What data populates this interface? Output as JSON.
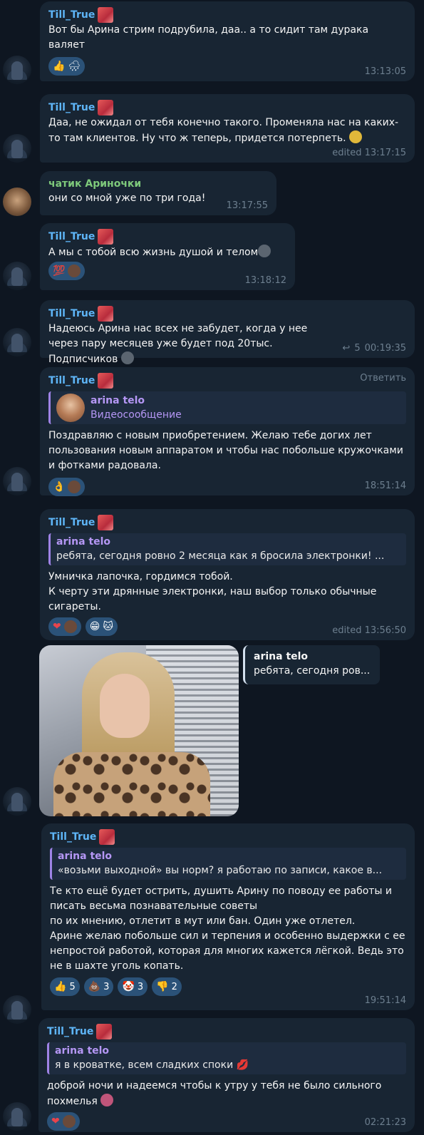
{
  "colors": {
    "background": "#0e1621",
    "bubble": "#182533",
    "name_blue": "#5eb5f7",
    "name_green": "#7ec97b",
    "quote_purple": "#b597f5",
    "time_gray": "#6d7f8f"
  },
  "messages": [
    {
      "author": "Till_True",
      "text": "Вот бы Арина стрим подрубила, даа.. а то сидит там дурака валяет",
      "reactions": [
        "👍",
        "🌧"
      ],
      "time": "13:13:05"
    },
    {
      "author": "Till_True",
      "text": "Даа, не ожидал от тебя конечно такого. Променяла нас на каких-то там клиентов. Ну что ж теперь, придется потерпеть.",
      "time": "edited 13:17:15"
    },
    {
      "author": "чатик Ариночки",
      "text": "они со мной уже по три года!",
      "time": "13:17:55"
    },
    {
      "author": "Till_True",
      "text": "А мы с тобой всю жизнь душой и телом",
      "reactions": [
        "💯",
        ""
      ],
      "time": "13:18:12"
    },
    {
      "author": "Till_True",
      "text": "Надеюсь Арина нас всех не забудет, когда у нее через пару месяцев уже будет под 20тыс. Подписчиков",
      "reply_count": "5",
      "time": "00:19:35"
    },
    {
      "author": "Till_True",
      "reply_action": "Ответить",
      "quote_name": "arina telo",
      "quote_text": "Видеосообщение",
      "text": "Поздравляю с новым приобретением. Желаю тебе догих лет пользования новым аппаратом и чтобы нас побольше кружочками и фотками радовала.",
      "reactions": [
        "👌",
        ""
      ],
      "time": "18:51:14"
    },
    {
      "author": "Till_True",
      "quote_name": "arina telo",
      "quote_text": "ребята, сегодня ровно 2 месяца как я бросила электронки!  ...",
      "text": "Умничка лапочка, гордимся тобой.\nК черту эти дрянные электронки, наш выбор только обычные сигареты.",
      "reactions": [
        "❤",
        "",
        "😁",
        "🐱"
      ],
      "time": "edited 13:56:50"
    },
    {
      "author": "arina telo",
      "quote_text": "ребята, сегодня ров..."
    },
    {
      "author": "Till_True",
      "quote_name": "arina telo",
      "quote_text": "«возьми выходной» вы норм? я работаю по записи, какое в...",
      "text": "Те кто ещё будет острить, душить Арину по поводу ее работы и писать весьма познавательные советы\nпо их мнению, отлетит в мут или бан. Один уже отлетел.\nАрине желаю побольше сил и терпения и особенно выдержки с ее непростой работой, которая для многих кажется лёгкой. Ведь это не в шахте уголь копать.",
      "reactions": [
        {
          "emoji": "👍",
          "count": "5"
        },
        {
          "emoji": "💩",
          "count": "3"
        },
        {
          "emoji": "🤡",
          "count": "3"
        },
        {
          "emoji": "👎",
          "count": "2"
        }
      ],
      "time": "19:51:14"
    },
    {
      "author": "Till_True",
      "quote_name": "arina telo",
      "quote_text": "я в кроватке, всем сладких споки 💋",
      "text": "доброй ночи и надеемся чтобы к утру у тебя не было сильного похмелья",
      "reactions": [
        "❤",
        ""
      ],
      "time": "02:21:23"
    }
  ]
}
